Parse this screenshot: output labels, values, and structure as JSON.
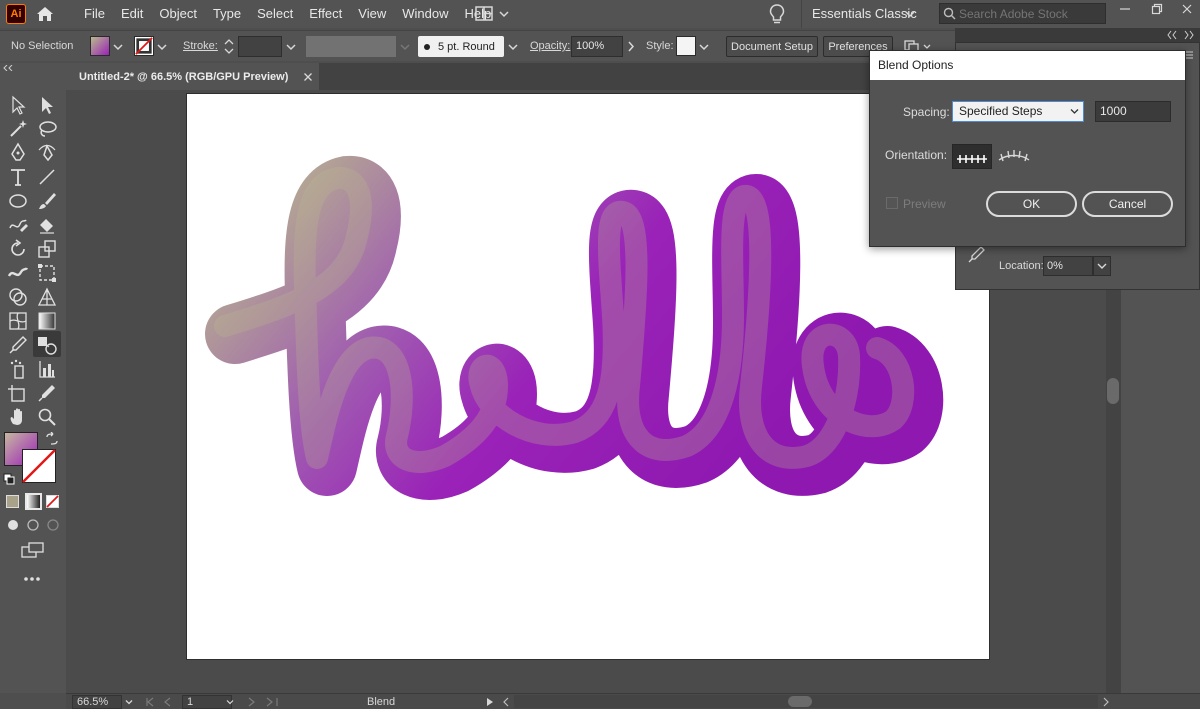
{
  "app": {
    "logo": "Ai"
  },
  "menu": [
    "File",
    "Edit",
    "Object",
    "Type",
    "Select",
    "Effect",
    "View",
    "Window",
    "Help"
  ],
  "workspace": {
    "name": "Essentials Classic",
    "search_placeholder": "Search Adobe Stock"
  },
  "control_bar": {
    "selection": "No Selection",
    "stroke_label": "Stroke:",
    "brush": "5 pt. Round",
    "opacity_label": "Opacity:",
    "opacity_value": "100%",
    "style_label": "Style:",
    "document_setup": "Document Setup",
    "preferences": "Preferences"
  },
  "tab": {
    "title": "Untitled-2* @ 66.5% (RGB/GPU Preview)"
  },
  "canvas": {
    "artwork_text": "hello",
    "gradient_start": "#9a22b8",
    "gradient_end": "#b9bb8c"
  },
  "blend_dialog": {
    "title": "Blend Options",
    "spacing_label": "Spacing:",
    "spacing_value": "Specified Steps",
    "steps": "1000",
    "orientation_label": "Orientation:",
    "preview_label": "Preview",
    "preview_checked": false,
    "ok": "OK",
    "cancel": "Cancel"
  },
  "gradient_panel": {
    "location_label": "Location:",
    "location_value": "0%"
  },
  "status_bar": {
    "zoom": "66.5%",
    "artboard": "1",
    "status": "Blend"
  },
  "colors": {
    "accent_purple": "#9a22b8",
    "dialog_focus": "#4d8bd6"
  }
}
